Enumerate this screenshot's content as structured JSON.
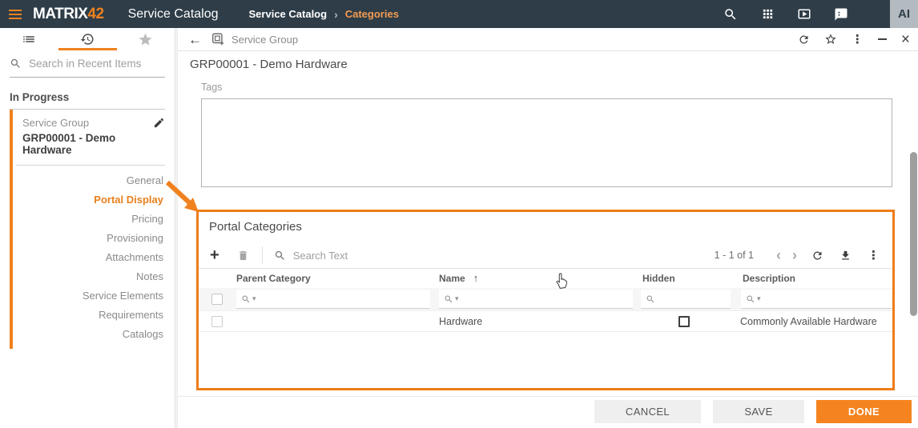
{
  "icons": {
    "kebab": "⋮",
    "close": "×",
    "back": "←",
    "sort_asc": "↑",
    "caret_down": "▾",
    "breadcrumb_sep": "›",
    "chevron_left": "‹",
    "chevron_right": "›",
    "plus": "+"
  },
  "topbar": {
    "logo_primary": "MATRIX",
    "logo_accent": "42",
    "app_title": "Service Catalog",
    "breadcrumb": {
      "root": "Service Catalog",
      "current": "Categories"
    },
    "avatar": "AI"
  },
  "sidebar": {
    "search_placeholder": "Search in Recent Items",
    "section_title": "In Progress",
    "active_record": {
      "type": "Service Group",
      "title": "GRP00001 - Demo Hardware"
    },
    "nav_items": [
      {
        "label": "General",
        "active": false
      },
      {
        "label": "Portal Display",
        "active": true
      },
      {
        "label": "Pricing",
        "active": false
      },
      {
        "label": "Provisioning",
        "active": false
      },
      {
        "label": "Attachments",
        "active": false
      },
      {
        "label": "Notes",
        "active": false
      },
      {
        "label": "Service Elements",
        "active": false
      },
      {
        "label": "Requirements",
        "active": false
      },
      {
        "label": "Catalogs",
        "active": false
      }
    ]
  },
  "main": {
    "header": {
      "object_type": "Service Group"
    },
    "page_title": "GRP00001 - Demo Hardware",
    "tags_label": "Tags",
    "portal_categories": {
      "title": "Portal Categories",
      "toolbar": {
        "search_placeholder": "Search Text",
        "range_label": "1 - 1 of 1"
      },
      "table": {
        "columns": [
          {
            "label": "Parent Category"
          },
          {
            "label": "Name"
          },
          {
            "label": "Hidden"
          },
          {
            "label": "Description"
          }
        ],
        "sort": {
          "column": "Name",
          "direction": "ascending"
        },
        "rows": [
          {
            "parent_category": "",
            "name": "Hardware",
            "hidden": false,
            "description": "Commonly Available Hardware"
          }
        ]
      }
    }
  },
  "footer": {
    "cancel": "CANCEL",
    "save": "SAVE",
    "done": "DONE"
  },
  "colors": {
    "accent": "#F0811F",
    "topbar_bg": "#2E3D48",
    "done_button": "#F5831F"
  }
}
